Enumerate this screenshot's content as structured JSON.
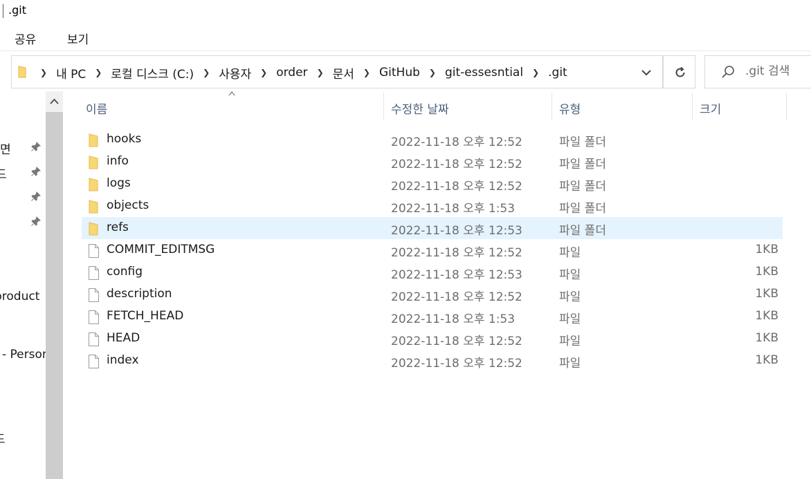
{
  "window": {
    "title": ".git"
  },
  "ribbon": {
    "tabs": [
      "공유",
      "보기"
    ]
  },
  "address": {
    "crumbs": [
      "내 PC",
      "로컬 디스크 (C:)",
      "사용자",
      "order",
      "문서",
      "GitHub",
      "git-essesntial",
      ".git"
    ]
  },
  "search": {
    "placeholder": ".git 검색"
  },
  "nav_pane": {
    "items": [
      {
        "label": "면",
        "pinned": true
      },
      {
        "label": "드",
        "pinned": true
      },
      {
        "label": "",
        "pinned": true
      },
      {
        "label": "",
        "pinned": true
      },
      {
        "label": "product",
        "pinned": false
      },
      {
        "label": "- Person",
        "pinned": false
      },
      {
        "label": "드",
        "pinned": false
      }
    ]
  },
  "columns": {
    "name": "이름",
    "date": "수정한 날짜",
    "type": "유형",
    "size": "크기"
  },
  "files": [
    {
      "name": "hooks",
      "date": "2022-11-18 오후 12:52",
      "type": "파일 폴더",
      "size": "",
      "icon": "folder-icon"
    },
    {
      "name": "info",
      "date": "2022-11-18 오후 12:52",
      "type": "파일 폴더",
      "size": "",
      "icon": "folder-icon"
    },
    {
      "name": "logs",
      "date": "2022-11-18 오후 12:52",
      "type": "파일 폴더",
      "size": "",
      "icon": "folder-icon"
    },
    {
      "name": "objects",
      "date": "2022-11-18 오후 1:53",
      "type": "파일 폴더",
      "size": "",
      "icon": "folder-icon"
    },
    {
      "name": "refs",
      "date": "2022-11-18 오후 12:53",
      "type": "파일 폴더",
      "size": "",
      "icon": "folder-icon",
      "selected": true
    },
    {
      "name": "COMMIT_EDITMSG",
      "date": "2022-11-18 오후 12:52",
      "type": "파일",
      "size": "1KB",
      "icon": "file-icon"
    },
    {
      "name": "config",
      "date": "2022-11-18 오후 12:53",
      "type": "파일",
      "size": "1KB",
      "icon": "file-icon"
    },
    {
      "name": "description",
      "date": "2022-11-18 오후 12:52",
      "type": "파일",
      "size": "1KB",
      "icon": "file-icon"
    },
    {
      "name": "FETCH_HEAD",
      "date": "2022-11-18 오후 1:53",
      "type": "파일",
      "size": "1KB",
      "icon": "file-icon"
    },
    {
      "name": "HEAD",
      "date": "2022-11-18 오후 12:52",
      "type": "파일",
      "size": "1KB",
      "icon": "file-icon"
    },
    {
      "name": "index",
      "date": "2022-11-18 오후 12:52",
      "type": "파일",
      "size": "1KB",
      "icon": "file-icon"
    }
  ],
  "colors": {
    "folder": "#f8d775",
    "selection": "#e5f3ff",
    "header_text": "#4c607a"
  }
}
